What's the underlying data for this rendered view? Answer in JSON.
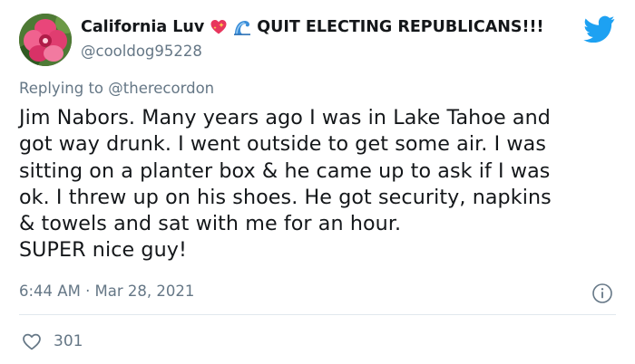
{
  "tweet": {
    "display_name": "California Luv",
    "display_name_suffix": "QUIT ELECTING REPUBLICANS!!!",
    "handle": "@cooldog95228",
    "replying_prefix": "Replying to",
    "replying_to": "@therecordon",
    "body_lines": [
      "Jim Nabors. Many years ago I was in Lake Tahoe and",
      "got way drunk. I went outside to get some air. I was",
      "sitting on a planter box & he came up to ask if I was",
      "ok. I threw up on his shoes. He got security, napkins",
      "& towels and sat with me for an hour.",
      "SUPER nice guy!"
    ],
    "timestamp": "6:44 AM · Mar 28, 2021",
    "like_count": "301"
  },
  "icons": {
    "heart_emoji": "sparkling-heart-emoji",
    "wave_emoji": "water-wave-emoji",
    "brand": "twitter-bird-icon",
    "info": "info-icon",
    "like": "heart-outline-icon"
  },
  "colors": {
    "brand_blue": "#1da1f2",
    "secondary_text": "#657786",
    "primary_text": "#14171a",
    "divider": "#e1e8ed"
  }
}
